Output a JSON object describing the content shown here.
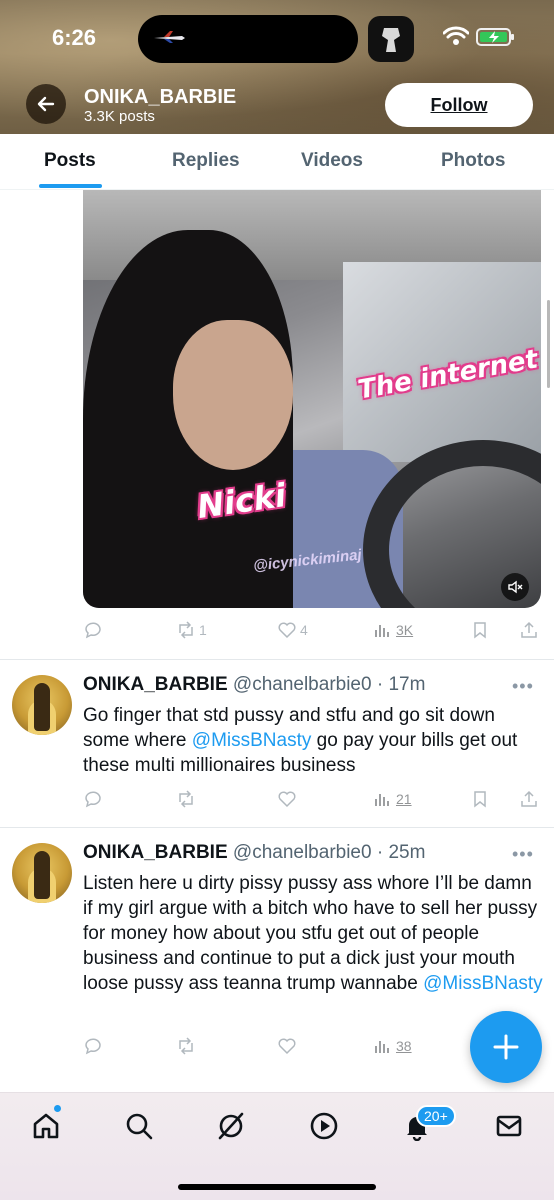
{
  "status_bar": {
    "time": "6:26"
  },
  "profile": {
    "name": "ONIKA_BARBIE",
    "post_count": "3.3K posts",
    "follow_label": "Follow"
  },
  "tabs": [
    {
      "label": "Posts"
    },
    {
      "label": "Replies"
    },
    {
      "label": "Videos"
    },
    {
      "label": "Photos"
    }
  ],
  "media_post": {
    "overlay_internet": "The internet",
    "overlay_nicki": "Nicki",
    "watermark": "@icynickiminaj",
    "retweets": "1",
    "likes": "4",
    "views": "3K"
  },
  "tweets": [
    {
      "name": "ONIKA_BARBIE",
      "meta": "@chanelbarbie0 · 17m",
      "text_before": "Go finger that std pussy and stfu and go sit down some where ",
      "mention": "@MissBNasty",
      "text_after": " go pay your bills get out these multi millionaires business",
      "views": "21"
    },
    {
      "name": "ONIKA_BARBIE",
      "meta": "@chanelbarbie0 · 25m",
      "text_before": "Listen here u dirty pissy pussy ass whore I’ll be damn if my girl argue with a bitch who have to sell her pussy for money how about you stfu get out of people business and continue to put a dick just your mouth loose pussy ass teanna trump wannabe ",
      "mention": "@MissBNasty",
      "text_after": "",
      "views": "38"
    }
  ],
  "bottom_nav": {
    "notifications_badge": "20+"
  },
  "colors": {
    "accent": "#1d9bf0",
    "text": "#0f1419",
    "secondary": "#536471"
  },
  "icons": [
    "back-arrow-icon",
    "wifi-icon",
    "battery-icon",
    "reply-icon",
    "retweet-icon",
    "like-icon",
    "views-icon",
    "bookmark-icon",
    "share-icon",
    "home-icon",
    "search-icon",
    "grok-icon",
    "video-icon",
    "bell-icon",
    "mail-icon",
    "plus-icon",
    "mute-icon"
  ]
}
